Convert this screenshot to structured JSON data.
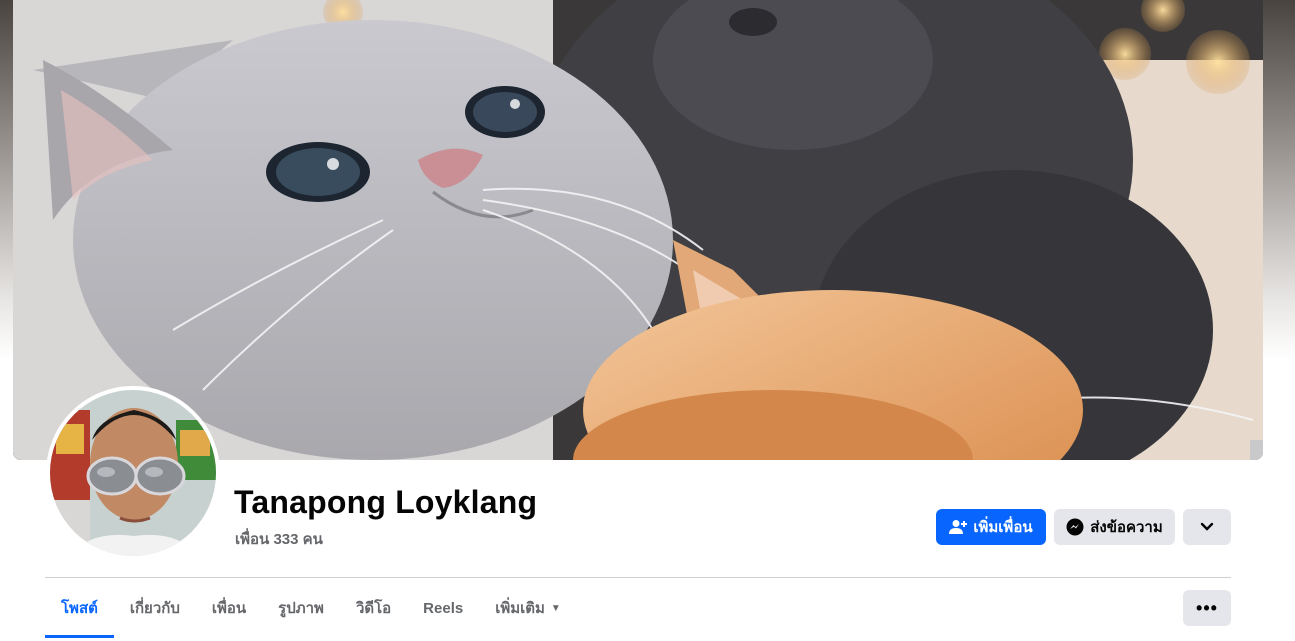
{
  "profile": {
    "name": "Tanapong Loyklang",
    "friends_count": "เพื่อน 333 คน"
  },
  "actions": {
    "add_friend_label": "เพิ่มเพื่อน",
    "message_label": "ส่งข้อความ",
    "add_friend_icon": "add-person-icon",
    "message_icon": "messenger-icon",
    "more_icon": "chevron-down-icon"
  },
  "tabs": [
    {
      "label": "โพสต์",
      "active": true
    },
    {
      "label": "เกี่ยวกับ",
      "active": false
    },
    {
      "label": "เพื่อน",
      "active": false
    },
    {
      "label": "รูปภาพ",
      "active": false
    },
    {
      "label": "วิดีโอ",
      "active": false
    },
    {
      "label": "Reels",
      "active": false
    },
    {
      "label": "เพิ่มเติม",
      "active": false
    }
  ],
  "tab_more_button_icon": "ellipsis-icon",
  "colors": {
    "primary": "#0866ff",
    "secondary_button": "#e4e6eb",
    "text_secondary": "#65676b"
  }
}
